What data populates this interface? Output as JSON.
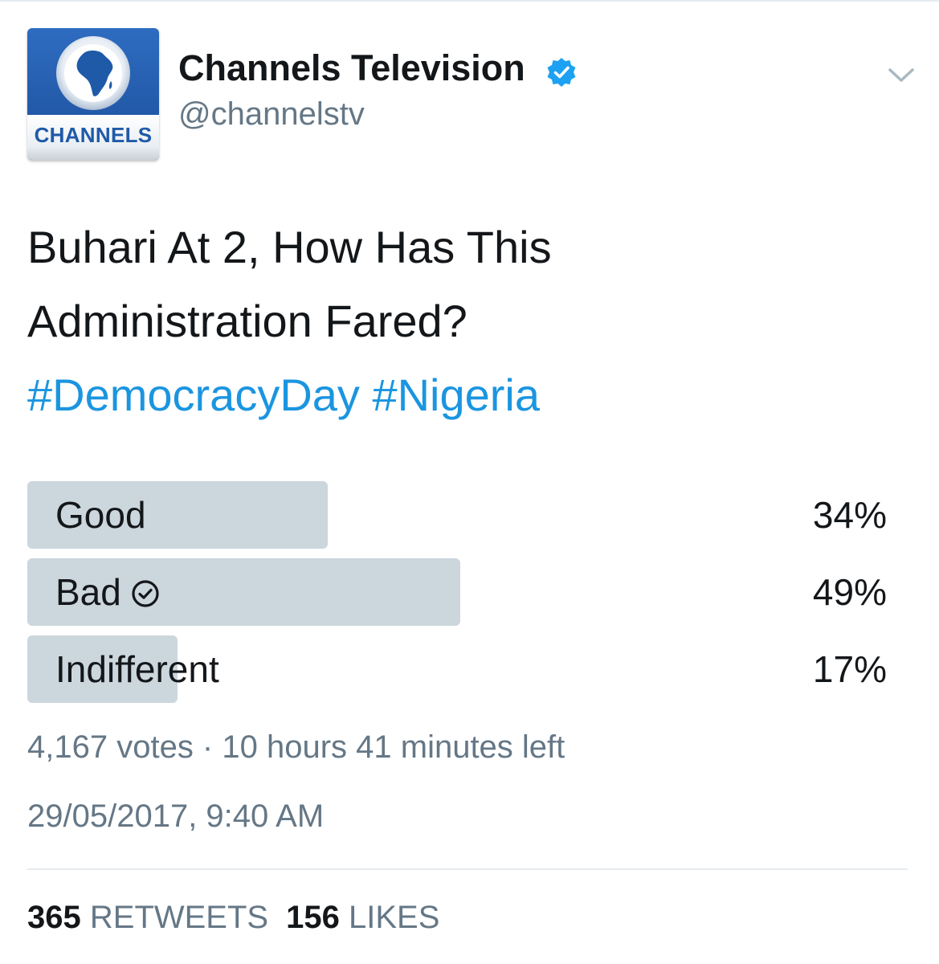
{
  "tweet": {
    "author": {
      "display_name": "Channels Television",
      "handle": "@channelstv",
      "avatar_brand": "CHANNELS",
      "verified": true
    },
    "text_lines": [
      "Buhari At 2, How Has This",
      "Administration Fared?"
    ],
    "hashtags": [
      "#DemocracyDay",
      "#Nigeria"
    ],
    "poll": {
      "options": [
        {
          "label": "Good",
          "percent_text": "34%",
          "fraction": 0.34,
          "selected": false
        },
        {
          "label": "Bad",
          "percent_text": "49%",
          "fraction": 0.49,
          "selected": true
        },
        {
          "label": "Indifferent",
          "percent_text": "17%",
          "fraction": 0.17,
          "selected": false
        }
      ],
      "meta": "4,167 votes · 10 hours 41 minutes left"
    },
    "timestamp": "29/05/2017, 9:40 AM",
    "stats": {
      "retweets_count": "365",
      "retweets_label": "RETWEETS",
      "likes_count": "156",
      "likes_label": "LIKES"
    }
  },
  "colors": {
    "hashtag": "#1b95e0",
    "verified": "#1da1f2",
    "poll_bar": "#ccd6dd",
    "muted_text": "#657786"
  },
  "icons": {
    "verified": "verified-badge-icon",
    "menu": "chevron-down-icon",
    "selected_option": "check-circle-icon"
  }
}
